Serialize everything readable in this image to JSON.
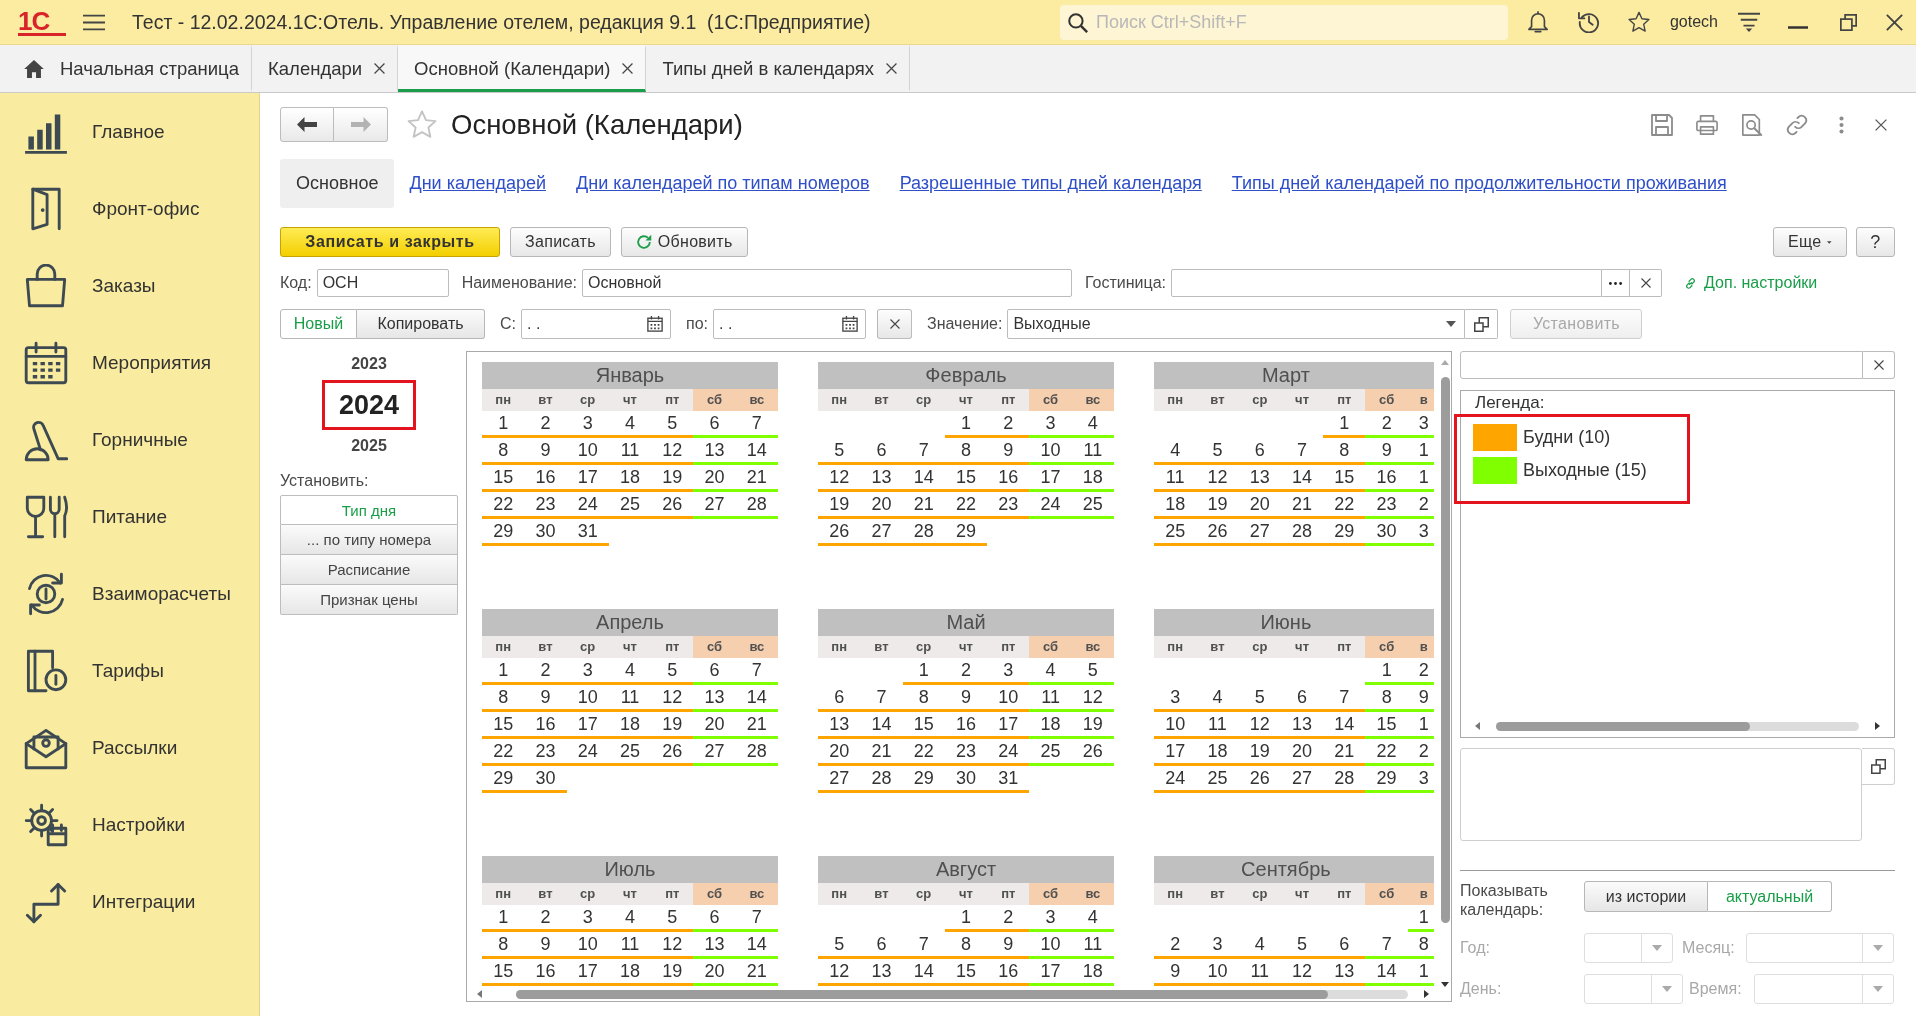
{
  "top_bar": {
    "logo": "1С",
    "title": "Тест - 12.02.2024.1С:Отель. Управление отелем, редакция 9.1  (1С:Предприятие)",
    "search": {
      "placeholder": "Поиск Ctrl+Shift+F"
    },
    "user": "gotech"
  },
  "tabs": [
    {
      "label": "Начальная страница",
      "kind": "home",
      "selected": false
    },
    {
      "label": "Календари",
      "kind": "closable",
      "selected": false
    },
    {
      "label": "Основной (Календари)",
      "kind": "closable",
      "selected": true
    },
    {
      "label": "Типы дней в календарях",
      "kind": "closable",
      "selected": false
    }
  ],
  "sidebar": {
    "items": [
      "Главное",
      "Фронт-офис",
      "Заказы",
      "Мероприятия",
      "Горничные",
      "Питание",
      "Взаиморасчеты",
      "Тарифы",
      "Рассылки",
      "Настройки",
      "Интеграции"
    ]
  },
  "form": {
    "title": "Основной (Календари)",
    "favorite": false,
    "back_disabled": false,
    "forward_disabled": true,
    "sections": [
      {
        "label": "Основное",
        "selected": true
      },
      {
        "label": "Дни календарей",
        "selected": false
      },
      {
        "label": "Дни календарей по типам номеров",
        "selected": false
      },
      {
        "label": "Разрешенные типы дней календаря",
        "selected": false
      },
      {
        "label": "Типы дней календарей по продолжительности проживания",
        "selected": false
      }
    ],
    "commands": [
      {
        "label": "Записать и закрыть",
        "kind": "primary"
      },
      {
        "label": "Записать",
        "kind": "plain"
      },
      {
        "label": "Обновить",
        "kind": "refresh"
      }
    ],
    "more_label": "Еще",
    "help_label": "?",
    "fields": [
      {
        "label": "Код:",
        "kind": "text",
        "value": "ОСН"
      },
      {
        "label": "Наименование:",
        "kind": "text",
        "value": "Основной"
      },
      {
        "label": "Гостиница:",
        "kind": "choice"
      }
    ],
    "extra_settings": "Доп. настройки",
    "period": {
      "modes": [
        {
          "label": "Новый",
          "selected": true
        },
        {
          "label": "Копировать",
          "selected": false
        }
      ],
      "from": {
        "label": "С:",
        "value": ". ."
      },
      "to": {
        "label": "по:",
        "value": ". ."
      },
      "value": {
        "label": "Значение:",
        "value": "Выходные"
      },
      "apply": {
        "label": "Установить",
        "disabled": true
      }
    }
  },
  "years": {
    "items": [
      {
        "label": "2023",
        "selected": false,
        "highlighted": false
      },
      {
        "label": "2024",
        "selected": true,
        "highlighted": true
      },
      {
        "label": "2025",
        "selected": false,
        "highlighted": false
      }
    ],
    "set_label": "Установить:",
    "set_buttons": [
      {
        "label": "Тип дня",
        "selected": true
      },
      {
        "label": "... по типу номера",
        "selected": false
      },
      {
        "label": "Расписание",
        "selected": false
      },
      {
        "label": "Признак цены",
        "selected": false
      }
    ]
  },
  "calendar": {
    "months": [
      {
        "name": "Январь",
        "weekdays": [
          {
            "label": "пн",
            "kind": "workday"
          },
          {
            "label": "вт",
            "kind": "workday"
          },
          {
            "label": "ср",
            "kind": "workday"
          },
          {
            "label": "чт",
            "kind": "workday"
          },
          {
            "label": "пт",
            "kind": "workday"
          },
          {
            "label": "сб",
            "kind": "weekend"
          },
          {
            "label": "вс",
            "kind": "weekend"
          }
        ],
        "weeks": [
          [
            "1",
            "2",
            "3",
            "4",
            "5",
            "6",
            "7"
          ],
          [
            "8",
            "9",
            "10",
            "11",
            "12",
            "13",
            "14"
          ],
          [
            "15",
            "16",
            "17",
            "18",
            "19",
            "20",
            "21"
          ],
          [
            "22",
            "23",
            "24",
            "25",
            "26",
            "27",
            "28"
          ],
          [
            "29",
            "30",
            "31"
          ]
        ]
      },
      {
        "name": "Февраль",
        "weekdays": [
          {
            "label": "пн",
            "kind": "workday"
          },
          {
            "label": "вт",
            "kind": "workday"
          },
          {
            "label": "ср",
            "kind": "workday"
          },
          {
            "label": "чт",
            "kind": "workday"
          },
          {
            "label": "пт",
            "kind": "workday"
          },
          {
            "label": "сб",
            "kind": "weekend"
          },
          {
            "label": "вс",
            "kind": "weekend"
          }
        ],
        "weeks": [
          [
            "1",
            "2",
            "3",
            "4"
          ],
          [
            "5",
            "6",
            "7",
            "8",
            "9",
            "10",
            "11"
          ],
          [
            "12",
            "13",
            "14",
            "15",
            "16",
            "17",
            "18"
          ],
          [
            "19",
            "20",
            "21",
            "22",
            "23",
            "24",
            "25"
          ],
          [
            "26",
            "27",
            "28",
            "29"
          ]
        ]
      },
      {
        "name": "Март",
        "weekdays": [
          {
            "label": "пн",
            "kind": "workday"
          },
          {
            "label": "вт",
            "kind": "workday"
          },
          {
            "label": "ср",
            "kind": "workday"
          },
          {
            "label": "чт",
            "kind": "workday"
          },
          {
            "label": "пт",
            "kind": "workday"
          },
          {
            "label": "сб",
            "kind": "weekend"
          },
          {
            "label": "в",
            "kind": "weekend"
          }
        ],
        "weeks": [
          [
            "1",
            "2",
            "3"
          ],
          [
            "4",
            "5",
            "6",
            "7",
            "8",
            "9",
            "1"
          ],
          [
            "11",
            "12",
            "13",
            "14",
            "15",
            "16",
            "1"
          ],
          [
            "18",
            "19",
            "20",
            "21",
            "22",
            "23",
            "2"
          ],
          [
            "25",
            "26",
            "27",
            "28",
            "29",
            "30",
            "3"
          ]
        ]
      },
      {
        "name": "Апрель",
        "weekdays": [
          {
            "label": "пн",
            "kind": "workday"
          },
          {
            "label": "вт",
            "kind": "workday"
          },
          {
            "label": "ср",
            "kind": "workday"
          },
          {
            "label": "чт",
            "kind": "workday"
          },
          {
            "label": "пт",
            "kind": "workday"
          },
          {
            "label": "сб",
            "kind": "weekend"
          },
          {
            "label": "вс",
            "kind": "weekend"
          }
        ],
        "weeks": [
          [
            "1",
            "2",
            "3",
            "4",
            "5",
            "6",
            "7"
          ],
          [
            "8",
            "9",
            "10",
            "11",
            "12",
            "13",
            "14"
          ],
          [
            "15",
            "16",
            "17",
            "18",
            "19",
            "20",
            "21"
          ],
          [
            "22",
            "23",
            "24",
            "25",
            "26",
            "27",
            "28"
          ],
          [
            "29",
            "30"
          ]
        ]
      },
      {
        "name": "Май",
        "weekdays": [
          {
            "label": "пн",
            "kind": "workday"
          },
          {
            "label": "вт",
            "kind": "workday"
          },
          {
            "label": "ср",
            "kind": "workday"
          },
          {
            "label": "чт",
            "kind": "workday"
          },
          {
            "label": "пт",
            "kind": "workday"
          },
          {
            "label": "сб",
            "kind": "weekend"
          },
          {
            "label": "вс",
            "kind": "weekend"
          }
        ],
        "weeks": [
          [
            "1",
            "2",
            "3",
            "4",
            "5"
          ],
          [
            "6",
            "7",
            "8",
            "9",
            "10",
            "11",
            "12"
          ],
          [
            "13",
            "14",
            "15",
            "16",
            "17",
            "18",
            "19"
          ],
          [
            "20",
            "21",
            "22",
            "23",
            "24",
            "25",
            "26"
          ],
          [
            "27",
            "28",
            "29",
            "30",
            "31"
          ]
        ]
      },
      {
        "name": "Июнь",
        "weekdays": [
          {
            "label": "пн",
            "kind": "workday"
          },
          {
            "label": "вт",
            "kind": "workday"
          },
          {
            "label": "ср",
            "kind": "workday"
          },
          {
            "label": "чт",
            "kind": "workday"
          },
          {
            "label": "пт",
            "kind": "workday"
          },
          {
            "label": "сб",
            "kind": "weekend"
          },
          {
            "label": "в",
            "kind": "weekend"
          }
        ],
        "weeks": [
          [
            "1",
            "2"
          ],
          [
            "3",
            "4",
            "5",
            "6",
            "7",
            "8",
            "9"
          ],
          [
            "10",
            "11",
            "12",
            "13",
            "14",
            "15",
            "1"
          ],
          [
            "17",
            "18",
            "19",
            "20",
            "21",
            "22",
            "2"
          ],
          [
            "24",
            "25",
            "26",
            "27",
            "28",
            "29",
            "3"
          ]
        ]
      },
      {
        "name": "Июль",
        "weekdays": [
          {
            "label": "пн",
            "kind": "workday"
          },
          {
            "label": "вт",
            "kind": "workday"
          },
          {
            "label": "ср",
            "kind": "workday"
          },
          {
            "label": "чт",
            "kind": "workday"
          },
          {
            "label": "пт",
            "kind": "workday"
          },
          {
            "label": "сб",
            "kind": "weekend"
          },
          {
            "label": "вс",
            "kind": "weekend"
          }
        ],
        "weeks": [
          [
            "1",
            "2",
            "3",
            "4",
            "5",
            "6",
            "7"
          ],
          [
            "8",
            "9",
            "10",
            "11",
            "12",
            "13",
            "14"
          ],
          [
            "15",
            "16",
            "17",
            "18",
            "19",
            "20",
            "21"
          ]
        ]
      },
      {
        "name": "Август",
        "weekdays": [
          {
            "label": "пн",
            "kind": "workday"
          },
          {
            "label": "вт",
            "kind": "workday"
          },
          {
            "label": "ср",
            "kind": "workday"
          },
          {
            "label": "чт",
            "kind": "workday"
          },
          {
            "label": "пт",
            "kind": "workday"
          },
          {
            "label": "сб",
            "kind": "weekend"
          },
          {
            "label": "вс",
            "kind": "weekend"
          }
        ],
        "weeks": [
          [
            "1",
            "2",
            "3",
            "4"
          ],
          [
            "5",
            "6",
            "7",
            "8",
            "9",
            "10",
            "11"
          ],
          [
            "12",
            "13",
            "14",
            "15",
            "16",
            "17",
            "18"
          ]
        ]
      },
      {
        "name": "Сентябрь",
        "weekdays": [
          {
            "label": "пн",
            "kind": "workday"
          },
          {
            "label": "вт",
            "kind": "workday"
          },
          {
            "label": "ср",
            "kind": "workday"
          },
          {
            "label": "чт",
            "kind": "workday"
          },
          {
            "label": "пт",
            "kind": "workday"
          },
          {
            "label": "сб",
            "kind": "weekend"
          },
          {
            "label": "в",
            "kind": "weekend"
          }
        ],
        "weeks": [
          [
            "1"
          ],
          [
            "2",
            "3",
            "4",
            "5",
            "6",
            "7",
            "8"
          ],
          [
            "9",
            "10",
            "11",
            "12",
            "13",
            "14",
            "1"
          ]
        ]
      }
    ]
  },
  "legend": {
    "title": "Легенда:",
    "highlighted": true,
    "items": [
      {
        "label": "Будни (10)",
        "kind": "workday",
        "color": "#ffa500"
      },
      {
        "label": "Выходные (15)",
        "kind": "weekend",
        "color": "#7fff00"
      }
    ]
  },
  "show_calendar": {
    "label": "Показывать календарь:",
    "options": [
      {
        "label": "из истории",
        "selected": false
      },
      {
        "label": "актуальный",
        "selected": true
      }
    ]
  },
  "date_fields": [
    {
      "label": "Год:",
      "disabled": true
    },
    {
      "label": "Месяц:",
      "disabled": true
    },
    {
      "label": "День:",
      "disabled": true
    },
    {
      "label": "Время:",
      "disabled": true
    }
  ]
}
